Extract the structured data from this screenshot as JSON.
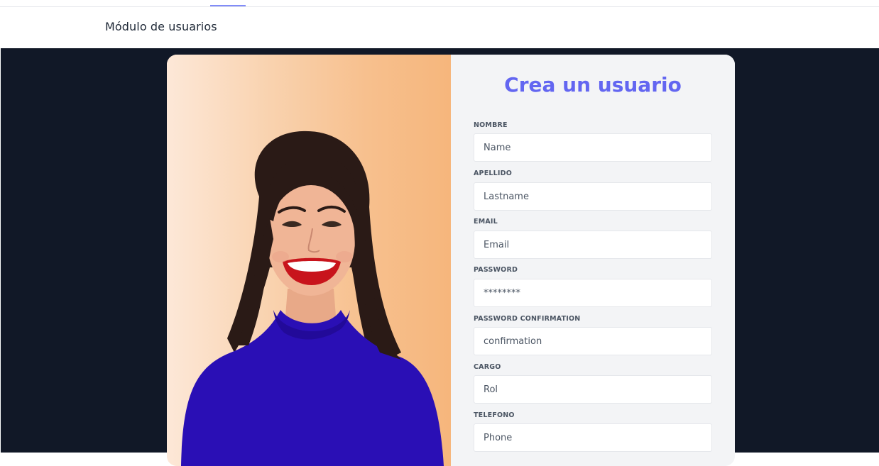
{
  "header": {
    "title": "Módulo de usuarios"
  },
  "form": {
    "title": "Crea un usuario",
    "fields": [
      {
        "label": "NOMBRE",
        "placeholder": "Name",
        "value": ""
      },
      {
        "label": "APELLIDO",
        "placeholder": "Lastname",
        "value": ""
      },
      {
        "label": "EMAIL",
        "placeholder": "Email",
        "value": ""
      },
      {
        "label": "PASSWORD",
        "placeholder": "********",
        "value": ""
      },
      {
        "label": "PASSWORD CONFIRMATION",
        "placeholder": "confirmation",
        "value": ""
      },
      {
        "label": "CARGO",
        "placeholder": "Rol",
        "value": ""
      },
      {
        "label": "TELEFONO",
        "placeholder": "Phone",
        "value": ""
      }
    ]
  },
  "colors": {
    "accent": "#6366f1",
    "background_dark": "#111827",
    "card_panel": "#f3f4f6"
  }
}
